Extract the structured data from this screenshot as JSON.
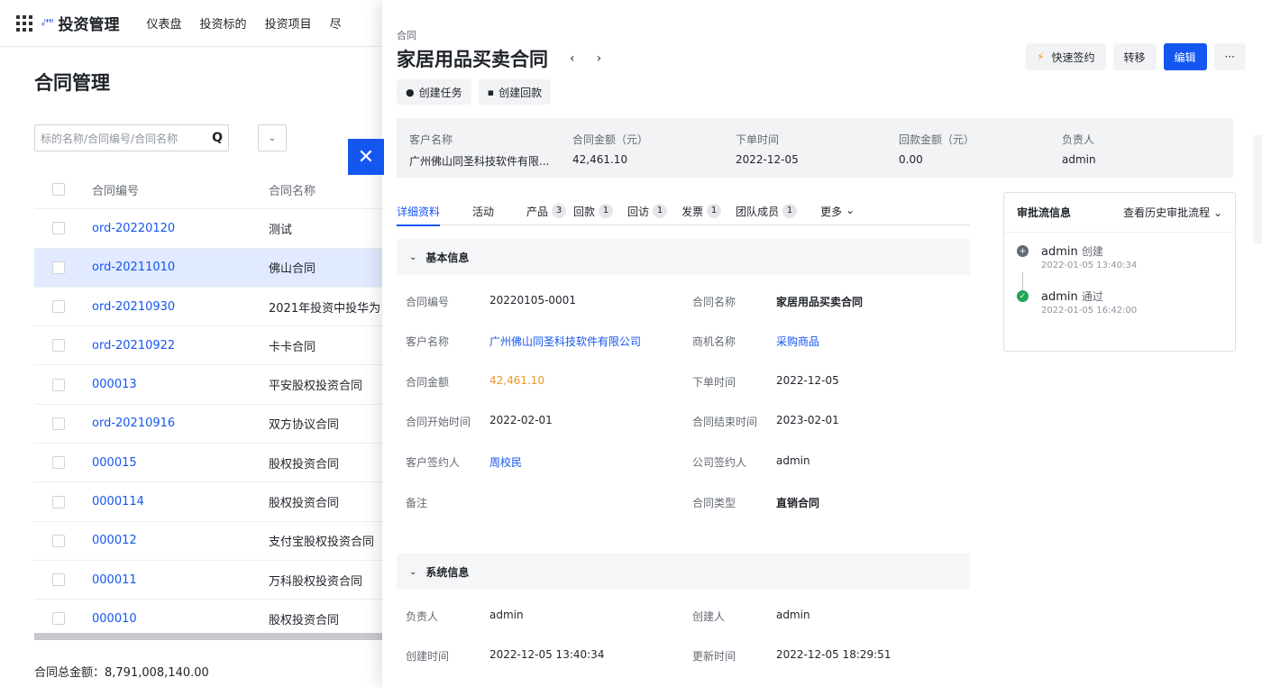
{
  "app": {
    "title": "投资管理",
    "logo_text": "ᵩᴴᴴᴴ",
    "nav": [
      "仪表盘",
      "投资标的",
      "投资项目",
      "尽"
    ]
  },
  "list_page": {
    "title": "合同管理",
    "search_placeholder": "标的名称/合同编号/合同名称",
    "columns": {
      "code": "合同编号",
      "name": "合同名称"
    },
    "rows": [
      {
        "code": "ord-20220120",
        "name": "测试"
      },
      {
        "code": "ord-20211010",
        "name": "佛山合同"
      },
      {
        "code": "ord-20210930",
        "name": "2021年投资中投华为"
      },
      {
        "code": "ord-20210922",
        "name": "卡卡合同"
      },
      {
        "code": "000013",
        "name": "平安股权投资合同"
      },
      {
        "code": "ord-20210916",
        "name": "双方协议合同"
      },
      {
        "code": "000015",
        "name": "股权投资合同"
      },
      {
        "code": "0000114",
        "name": "股权投资合同"
      },
      {
        "code": "000012",
        "name": "支付宝股权投资合同"
      },
      {
        "code": "000011",
        "name": "万科股权投资合同"
      },
      {
        "code": "000010",
        "name": "股权投资合同"
      }
    ],
    "selected_row_index": 1,
    "total_amount": "合同总金额：8,791,008,140.00"
  },
  "drawer": {
    "kind": "合同",
    "title": "家居用品买卖合同",
    "actions": {
      "quick_sign": "快速签约",
      "transfer": "转移",
      "edit": "编辑",
      "more": "···"
    },
    "sub_actions": {
      "create_task": "创建任务",
      "create_payment": "创建回款"
    },
    "summary": [
      {
        "label": "客户名称",
        "value": "广州佛山同圣科技软件有限..."
      },
      {
        "label": "合同金额（元）",
        "value": "42,461.10"
      },
      {
        "label": "下单时间",
        "value": "2022-12-05"
      },
      {
        "label": "回款金额（元）",
        "value": "0.00"
      },
      {
        "label": "负责人",
        "value": "admin"
      }
    ],
    "tabs": [
      {
        "label": "详细资料",
        "count": ""
      },
      {
        "label": "活动",
        "count": ""
      },
      {
        "label": "产品",
        "count": "3"
      },
      {
        "label": "回款",
        "count": "1"
      },
      {
        "label": "回访",
        "count": "1"
      },
      {
        "label": "发票",
        "count": "1"
      },
      {
        "label": "团队成员",
        "count": "1"
      },
      {
        "label": "更多",
        "count": ""
      }
    ],
    "basic": {
      "title": "基本信息",
      "contract_no": {
        "label": "合同编号",
        "value": "20220105-0001"
      },
      "contract_name": {
        "label": "合同名称",
        "value": "家居用品买卖合同"
      },
      "customer": {
        "label": "客户名称",
        "value": "广州佛山同圣科技软件有限公司"
      },
      "opportunity": {
        "label": "商机名称",
        "value": "采购商品"
      },
      "amount": {
        "label": "合同金额",
        "value": "42,461.10"
      },
      "order_time": {
        "label": "下单时间",
        "value": "2022-12-05"
      },
      "start": {
        "label": "合同开始时间",
        "value": "2022-02-01"
      },
      "end": {
        "label": "合同结束时间",
        "value": "2023-02-01"
      },
      "customer_signer": {
        "label": "客户签约人",
        "value": "周校民"
      },
      "company_signer": {
        "label": "公司签约人",
        "value": "admin"
      },
      "remark": {
        "label": "备注",
        "value": ""
      },
      "type": {
        "label": "合同类型",
        "value": "直销合同"
      }
    },
    "system": {
      "title": "系统信息",
      "owner": {
        "label": "负责人",
        "value": "admin"
      },
      "creator": {
        "label": "创建人",
        "value": "admin"
      },
      "created": {
        "label": "创建时间",
        "value": "2022-12-05 13:40:34"
      },
      "updated": {
        "label": "更新时间",
        "value": "2022-12-05 18:29:51"
      }
    },
    "approval": {
      "title": "审批流信息",
      "history": "查看历史审批流程",
      "steps": [
        {
          "user": "admin",
          "action": "创建",
          "time": "2022-01-05 13:40:34"
        },
        {
          "user": "admin",
          "action": "通过",
          "time": "2022-01-05 16:42:00"
        }
      ]
    }
  },
  "colors": {
    "primary": "#1456f0",
    "money": "#f0952a",
    "success": "#21a559"
  }
}
